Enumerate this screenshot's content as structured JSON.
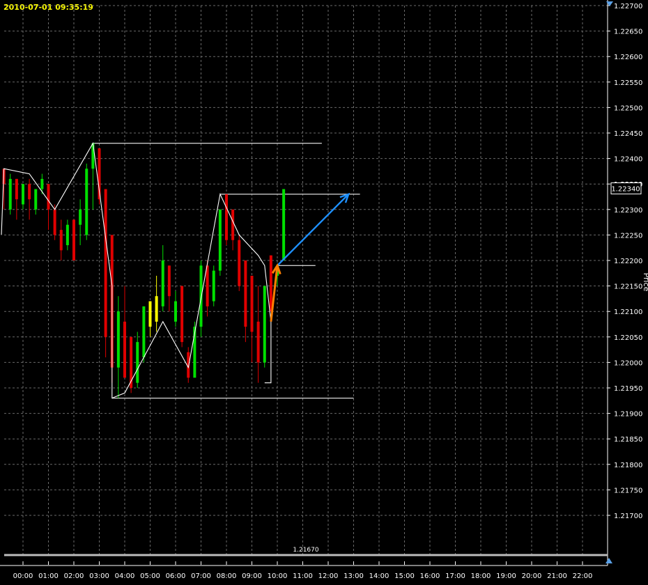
{
  "header": {
    "timestamp": "2010-07-01 09:35:19"
  },
  "price_axis": {
    "current_price_label": "1.22340",
    "side_label": "Price"
  },
  "colors": {
    "background": "#000000",
    "grid": "#6a6a6a",
    "axis_text": "#ffffff",
    "timestamp": "#ffff00",
    "bar_up": "#00e000",
    "bar_down": "#e00000",
    "bar_neutral": "#ffff00",
    "zigzag": "#ffffff",
    "arrow_projection": "#1e90ff",
    "arrow_small": "#ff7f00",
    "reference_line": "#c8c8c8"
  },
  "chart_data": {
    "type": "bar",
    "subtype": "price-bars",
    "ylim": [
      1.2166,
      1.227
    ],
    "y_ticks": [
      "1.22700",
      "1.22650",
      "1.22600",
      "1.22550",
      "1.22500",
      "1.22450",
      "1.22400",
      "1.22350",
      "1.22300",
      "1.22250",
      "1.22200",
      "1.22150",
      "1.22100",
      "1.22050",
      "1.22000",
      "1.21950",
      "1.21900",
      "1.21850",
      "1.21800",
      "1.21750",
      "1.21700"
    ],
    "x_ticks": [
      "00:00",
      "01:00",
      "02:00",
      "03:00",
      "04:00",
      "05:00",
      "06:00",
      "07:00",
      "08:00",
      "09:00",
      "10:00",
      "11:00",
      "12:00",
      "13:00",
      "14:00",
      "15:00",
      "16:00",
      "17:00",
      "18:00",
      "19:00",
      "20:00",
      "21:00",
      "22:00"
    ],
    "grid": true,
    "bars": [
      {
        "t": -0.75,
        "open": 1.2238,
        "close": 1.2235,
        "high": 1.2238,
        "low": 1.223,
        "color": "down"
      },
      {
        "t": -0.5,
        "open": 1.223,
        "close": 1.2236,
        "high": 1.2237,
        "low": 1.2229,
        "color": "up"
      },
      {
        "t": -0.25,
        "open": 1.2236,
        "close": 1.2232,
        "high": 1.2236,
        "low": 1.2228,
        "color": "down"
      },
      {
        "t": 0.0,
        "open": 1.2231,
        "close": 1.2235,
        "high": 1.2235,
        "low": 1.223,
        "color": "up"
      },
      {
        "t": 0.25,
        "open": 1.2235,
        "close": 1.2232,
        "high": 1.2236,
        "low": 1.2228,
        "color": "down"
      },
      {
        "t": 0.5,
        "open": 1.223,
        "close": 1.2234,
        "high": 1.2234,
        "low": 1.2229,
        "color": "up"
      },
      {
        "t": 0.75,
        "open": 1.2234,
        "close": 1.2236,
        "high": 1.2237,
        "low": 1.2233,
        "color": "up"
      },
      {
        "t": 1.0,
        "open": 1.2235,
        "close": 1.223,
        "high": 1.2235,
        "low": 1.2226,
        "color": "down"
      },
      {
        "t": 1.25,
        "open": 1.223,
        "close": 1.2225,
        "high": 1.2231,
        "low": 1.2224,
        "color": "down"
      },
      {
        "t": 1.5,
        "open": 1.2226,
        "close": 1.2222,
        "high": 1.2228,
        "low": 1.222,
        "color": "down"
      },
      {
        "t": 1.75,
        "open": 1.2223,
        "close": 1.2227,
        "high": 1.2228,
        "low": 1.2222,
        "color": "up"
      },
      {
        "t": 2.0,
        "open": 1.2228,
        "close": 1.222,
        "high": 1.2228,
        "low": 1.222,
        "color": "down"
      },
      {
        "t": 2.25,
        "open": 1.2227,
        "close": 1.223,
        "high": 1.2232,
        "low": 1.2223,
        "color": "up"
      },
      {
        "t": 2.5,
        "open": 1.2225,
        "close": 1.2238,
        "high": 1.2239,
        "low": 1.2224,
        "color": "up"
      },
      {
        "t": 2.75,
        "open": 1.2238,
        "close": 1.2243,
        "high": 1.2243,
        "low": 1.223,
        "color": "up"
      },
      {
        "t": 3.0,
        "open": 1.2242,
        "close": 1.2232,
        "high": 1.2242,
        "low": 1.2231,
        "color": "down"
      },
      {
        "t": 3.25,
        "open": 1.2234,
        "close": 1.2205,
        "high": 1.2234,
        "low": 1.2201,
        "color": "down"
      },
      {
        "t": 3.5,
        "open": 1.2225,
        "close": 1.2199,
        "high": 1.2225,
        "low": 1.2196,
        "color": "down"
      },
      {
        "t": 3.75,
        "open": 1.2199,
        "close": 1.221,
        "high": 1.2213,
        "low": 1.2193,
        "color": "up"
      },
      {
        "t": 4.0,
        "open": 1.2208,
        "close": 1.2197,
        "high": 1.2215,
        "low": 1.2197,
        "color": "down"
      },
      {
        "t": 4.25,
        "open": 1.2205,
        "close": 1.2195,
        "high": 1.2205,
        "low": 1.2194,
        "color": "down"
      },
      {
        "t": 4.5,
        "open": 1.2196,
        "close": 1.2204,
        "high": 1.2206,
        "low": 1.2195,
        "color": "up"
      },
      {
        "t": 4.75,
        "open": 1.2201,
        "close": 1.2211,
        "high": 1.2211,
        "low": 1.22,
        "color": "up"
      },
      {
        "t": 5.0,
        "open": 1.2212,
        "close": 1.2207,
        "high": 1.2212,
        "low": 1.2205,
        "color": "neutral"
      },
      {
        "t": 5.25,
        "open": 1.2208,
        "close": 1.2213,
        "high": 1.2217,
        "low": 1.2206,
        "color": "neutral"
      },
      {
        "t": 5.5,
        "open": 1.2211,
        "close": 1.222,
        "high": 1.2223,
        "low": 1.221,
        "color": "up"
      },
      {
        "t": 5.75,
        "open": 1.2219,
        "close": 1.2213,
        "high": 1.2219,
        "low": 1.221,
        "color": "down"
      },
      {
        "t": 6.0,
        "open": 1.2212,
        "close": 1.2208,
        "high": 1.2214,
        "low": 1.2207,
        "color": "up"
      },
      {
        "t": 6.25,
        "open": 1.2215,
        "close": 1.2204,
        "high": 1.2215,
        "low": 1.2203,
        "color": "down"
      },
      {
        "t": 6.5,
        "open": 1.2202,
        "close": 1.2197,
        "high": 1.2203,
        "low": 1.2196,
        "color": "down"
      },
      {
        "t": 6.75,
        "open": 1.2197,
        "close": 1.2207,
        "high": 1.2208,
        "low": 1.2199,
        "color": "up"
      },
      {
        "t": 7.0,
        "open": 1.2207,
        "close": 1.2219,
        "high": 1.222,
        "low": 1.2205,
        "color": "up"
      },
      {
        "t": 7.25,
        "open": 1.2219,
        "close": 1.2211,
        "high": 1.222,
        "low": 1.2209,
        "color": "down"
      },
      {
        "t": 7.5,
        "open": 1.2212,
        "close": 1.2218,
        "high": 1.2219,
        "low": 1.2211,
        "color": "up"
      },
      {
        "t": 7.75,
        "open": 1.2218,
        "close": 1.223,
        "high": 1.223,
        "low": 1.2217,
        "color": "up"
      },
      {
        "t": 8.0,
        "open": 1.2233,
        "close": 1.2224,
        "high": 1.2233,
        "low": 1.2223,
        "color": "down"
      },
      {
        "t": 8.25,
        "open": 1.223,
        "close": 1.2224,
        "high": 1.223,
        "low": 1.2222,
        "color": "down"
      },
      {
        "t": 8.5,
        "open": 1.2224,
        "close": 1.2215,
        "high": 1.2225,
        "low": 1.2214,
        "color": "down"
      },
      {
        "t": 8.75,
        "open": 1.222,
        "close": 1.2207,
        "high": 1.222,
        "low": 1.2204,
        "color": "down"
      },
      {
        "t": 9.0,
        "open": 1.2217,
        "close": 1.2206,
        "high": 1.2217,
        "low": 1.22,
        "color": "down"
      },
      {
        "t": 9.25,
        "open": 1.2208,
        "close": 1.22,
        "high": 1.2215,
        "low": 1.2196,
        "color": "down"
      },
      {
        "t": 9.5,
        "open": 1.22,
        "close": 1.2215,
        "high": 1.2215,
        "low": 1.2199,
        "color": "up"
      },
      {
        "t": 9.75,
        "open": 1.2221,
        "close": 1.221,
        "high": 1.2221,
        "low": 1.221,
        "color": "down"
      },
      {
        "t": 10.0,
        "open": 1.2217,
        "close": 1.2219,
        "high": 1.2219,
        "low": 1.2215,
        "color": "up"
      },
      {
        "t": 10.25,
        "open": 1.222,
        "close": 1.2234,
        "high": 1.2234,
        "low": 1.222,
        "color": "up"
      }
    ],
    "zigzag": [
      [
        -0.85,
        1.2225
      ],
      [
        -0.75,
        1.2238
      ],
      [
        0.25,
        1.2237
      ],
      [
        1.25,
        1.223
      ],
      [
        2.75,
        1.2243
      ],
      [
        3.5,
        1.2215
      ],
      [
        3.5,
        1.2193
      ],
      [
        4.0,
        1.2194
      ],
      [
        5.5,
        1.2208
      ],
      [
        6.5,
        1.2199
      ],
      [
        7.75,
        1.2233
      ],
      [
        8.5,
        1.2225
      ],
      [
        9.25,
        1.2221
      ],
      [
        9.5,
        1.2219
      ],
      [
        9.75,
        1.2208
      ],
      [
        9.75,
        1.2196
      ],
      [
        9.5,
        1.2196
      ]
    ],
    "reference_lines": [
      {
        "y": 1.2243,
        "t0": 2.75,
        "t1": 11.75
      },
      {
        "y": 1.2233,
        "t0": 7.75,
        "t1": 13.25
      },
      {
        "y": 1.2219,
        "t0": 10.0,
        "t1": 11.5
      },
      {
        "y": 1.2193,
        "t0": 3.5,
        "t1": 13.0
      }
    ],
    "arrows": [
      {
        "from": [
          10.0,
          1.2219
        ],
        "to": [
          12.8,
          1.2233
        ],
        "color": "arrow_projection"
      },
      {
        "from": [
          9.75,
          1.2208
        ],
        "to": [
          10.0,
          1.2219
        ],
        "color": "arrow_small"
      }
    ],
    "bottom_line_label": "1.21670"
  }
}
